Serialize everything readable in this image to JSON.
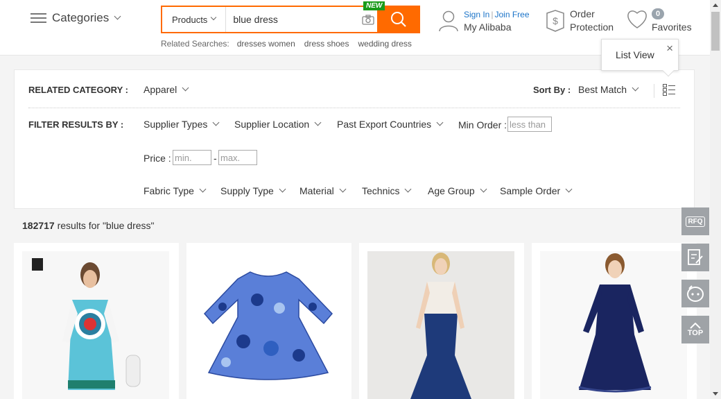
{
  "header": {
    "categories_label": "Categories",
    "search": {
      "type_label": "Products",
      "query": "blue dress",
      "new_badge": "NEW"
    },
    "related": {
      "label": "Related Searches:",
      "items": [
        "dresses women",
        "dress shoes",
        "wedding dress"
      ]
    },
    "account": {
      "sign_in": "Sign In",
      "join_free": "Join Free",
      "my_alibaba": "My Alibaba"
    },
    "order_protection": {
      "line1": "Order",
      "line2": "Protection"
    },
    "favorites": {
      "count": "0",
      "label": "Favorites"
    }
  },
  "filters": {
    "related_category_label": "RELATED CATEGORY :",
    "related_category_value": "Apparel",
    "sort_by_label": "Sort By :",
    "sort_by_value": "Best Match",
    "filter_label": "FILTER RESULTS BY :",
    "row1": [
      "Supplier Types",
      "Supplier Location",
      "Past Export Countries"
    ],
    "min_order_label": "Min Order :",
    "min_order_placeholder": "less than",
    "price_label": "Price :",
    "price_min_placeholder": "min.",
    "price_sep": "-",
    "price_max_placeholder": "max.",
    "row3": [
      "Fabric Type",
      "Supply Type",
      "Material",
      "Technics",
      "Age Group",
      "Sample Order"
    ],
    "tooltip": "List View",
    "tooltip_close": "×"
  },
  "results": {
    "count": "182717",
    "text": "results for \"blue dress\""
  },
  "side_tools": {
    "rfq": "RFQ",
    "top": "TOP"
  },
  "colors": {
    "accent": "#ff6a00",
    "link": "#1a73c8",
    "new_badge": "#1a9b1a",
    "tool_bg": "#9fa3a7"
  }
}
